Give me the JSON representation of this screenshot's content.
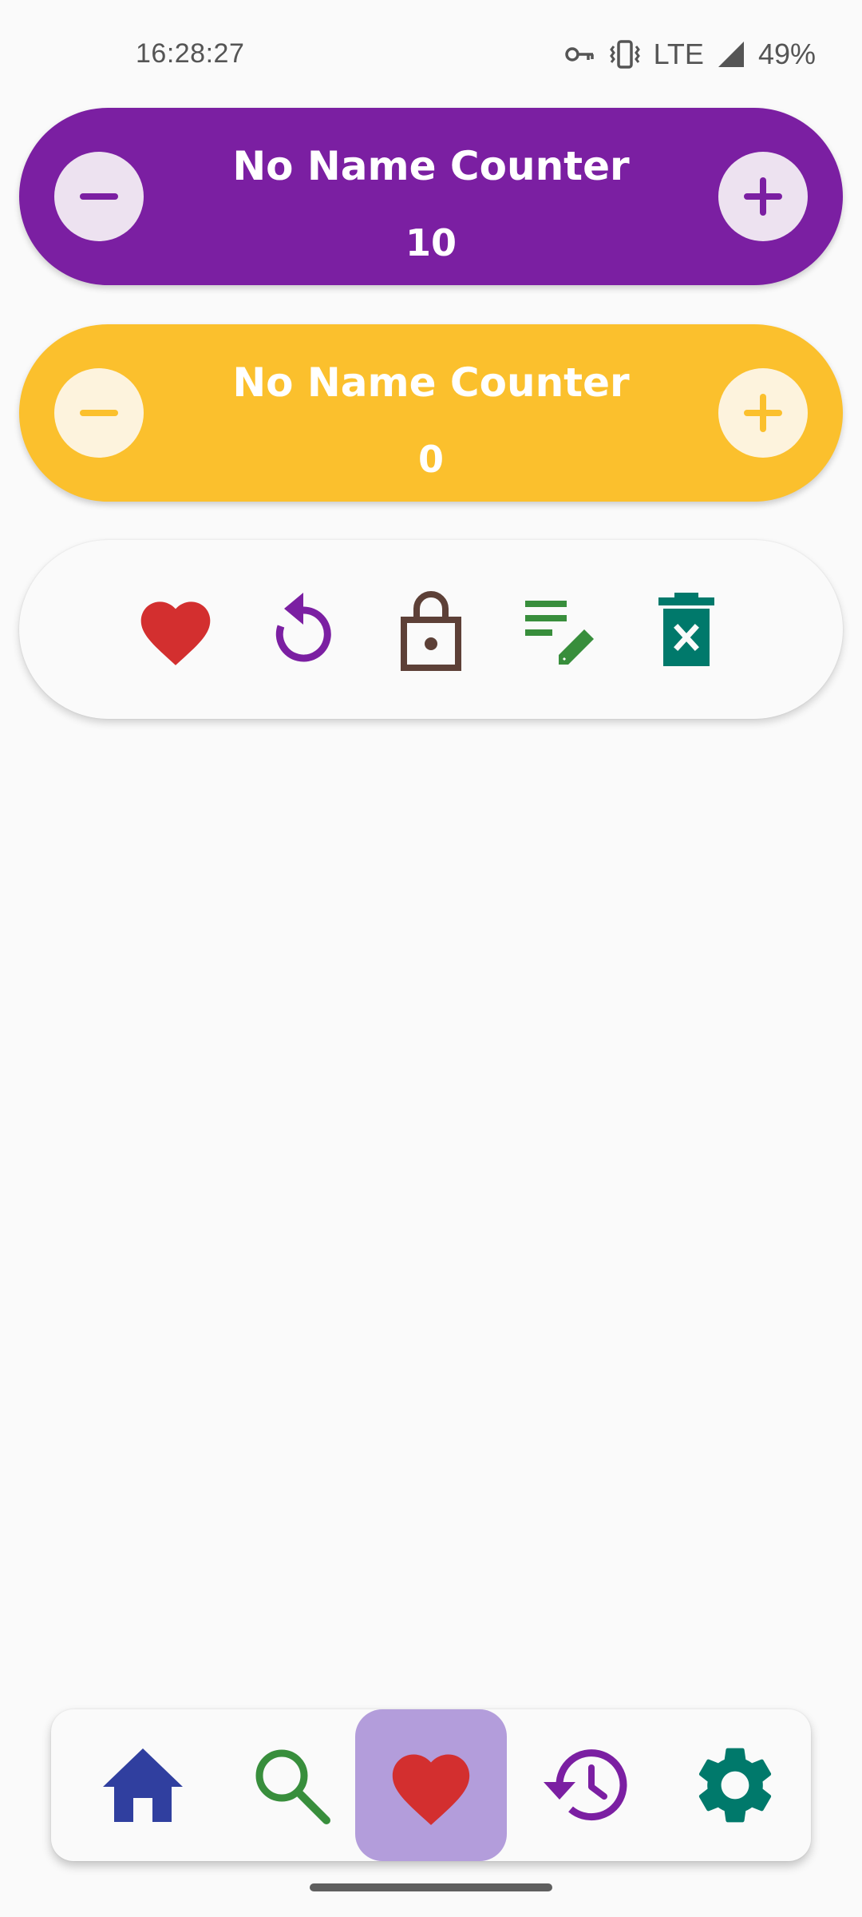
{
  "status_bar": {
    "time": "16:28:27",
    "network": "LTE",
    "battery": "49%",
    "icons": [
      "vpn-key-icon",
      "vibrate-icon",
      "signal-icon"
    ]
  },
  "counters": [
    {
      "name": "No Name Counter",
      "value": "10",
      "color": "#7b1fa2",
      "button_bg": "#ede2f0",
      "icon_color": "#7b1fa2",
      "minus_icon": "minus-icon",
      "plus_icon": "plus-icon"
    },
    {
      "name": "No Name Counter",
      "value": "0",
      "color": "#fbc02d",
      "button_bg": "#fdf3dd",
      "icon_color": "#fbc02d",
      "minus_icon": "minus-icon",
      "plus_icon": "plus-icon"
    }
  ],
  "actions": [
    {
      "icon": "heart-icon",
      "color": "#d32f2f"
    },
    {
      "icon": "reset-icon",
      "color": "#7b1fa2"
    },
    {
      "icon": "lock-icon",
      "color": "#5d4037"
    },
    {
      "icon": "edit-notes-icon",
      "color": "#388e3c"
    },
    {
      "icon": "delete-icon",
      "color": "#00796b"
    }
  ],
  "bottom_nav": {
    "active_index": 2,
    "items": [
      {
        "icon": "home-icon",
        "color": "#303f9f"
      },
      {
        "icon": "search-icon",
        "color": "#388e3c"
      },
      {
        "icon": "favorites-heart-icon",
        "color": "#d32f2f"
      },
      {
        "icon": "history-icon",
        "color": "#7b1fa2"
      },
      {
        "icon": "settings-gear-icon",
        "color": "#00796b"
      }
    ]
  }
}
